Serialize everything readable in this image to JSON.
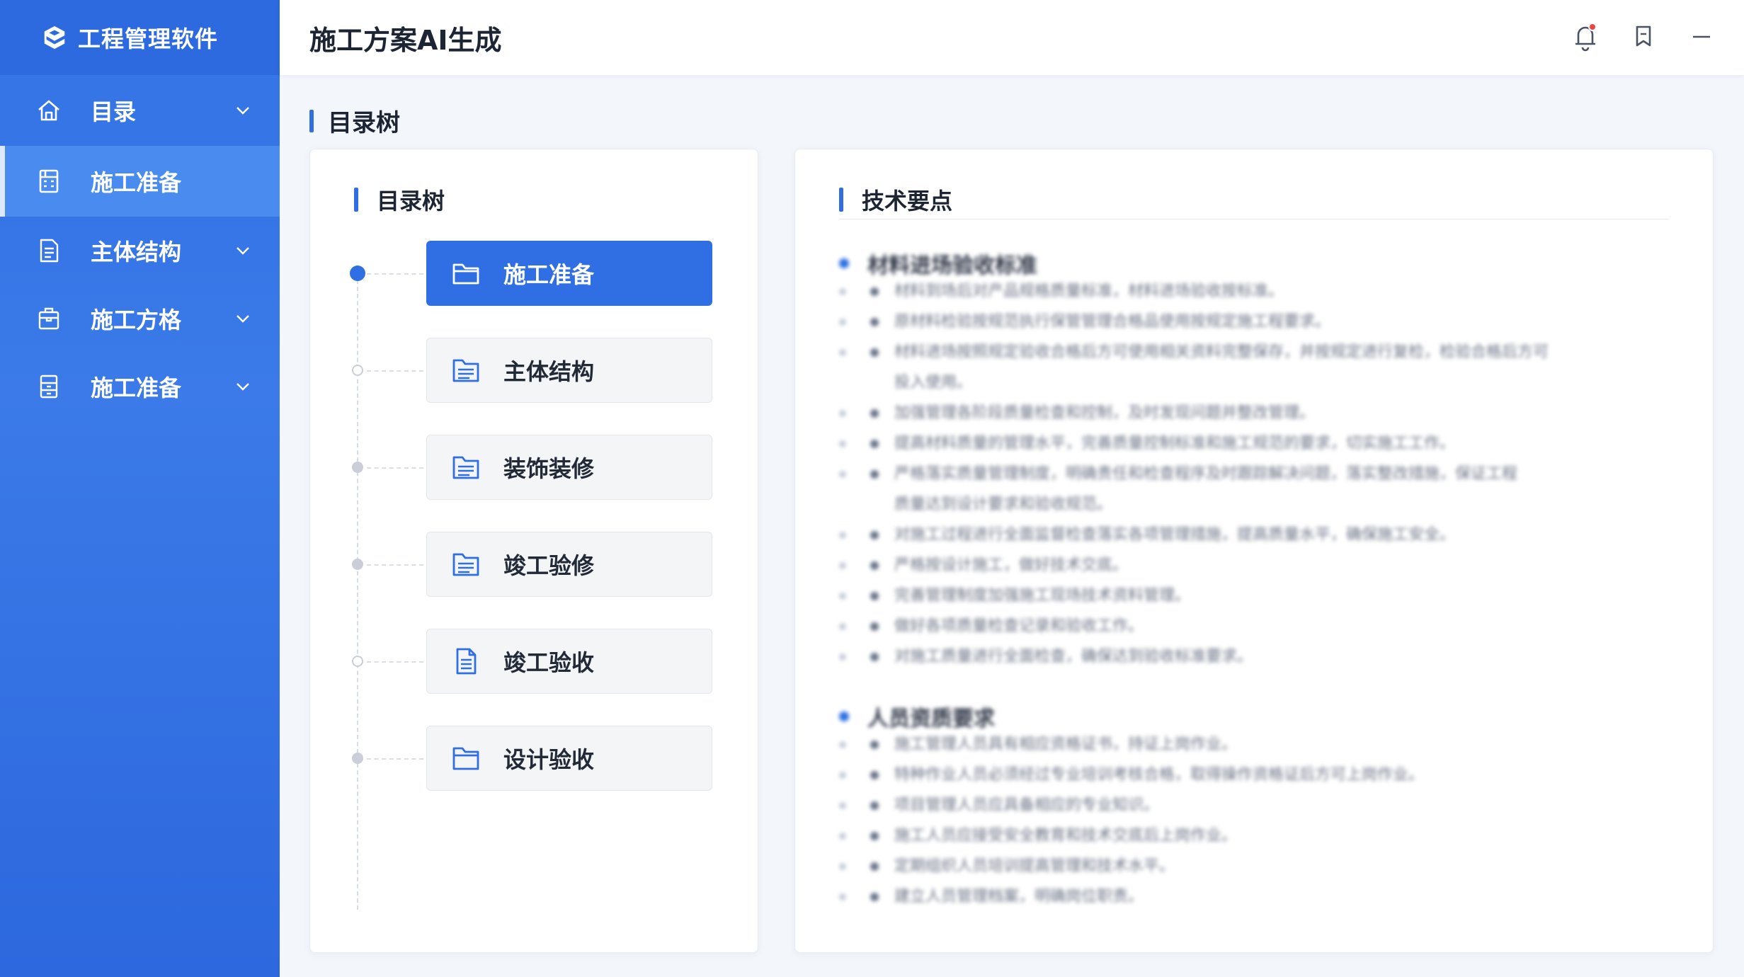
{
  "app": {
    "brand": "工程管理软件",
    "page_title": "施工方案AI生成"
  },
  "sidebar": {
    "items": [
      {
        "label": "目录",
        "icon": "home-icon",
        "expandable": true
      },
      {
        "label": "施工准备",
        "icon": "calculator-icon",
        "active": true
      },
      {
        "label": "主体结构",
        "icon": "document-icon",
        "expandable": true
      },
      {
        "label": "施工方格",
        "icon": "briefcase-icon",
        "expandable": true
      },
      {
        "label": "施工准备",
        "icon": "cabinet-icon",
        "expandable": true
      }
    ]
  },
  "header": {
    "icons": [
      "bell-icon",
      "bookmark-icon",
      "minimize-icon"
    ]
  },
  "section": {
    "title": "目录树"
  },
  "tree_panel": {
    "title": "目录树",
    "nodes": [
      {
        "label": "施工准备",
        "active": true,
        "icon": "folder-icon"
      },
      {
        "label": "主体结构",
        "icon": "folder-lines-icon"
      },
      {
        "label": "装饰装修",
        "icon": "folder-lines-icon"
      },
      {
        "label": "竣工验修",
        "icon": "folder-lines-icon"
      },
      {
        "label": "竣工验收",
        "icon": "document-icon"
      },
      {
        "label": "设计验收",
        "icon": "folder-icon"
      }
    ]
  },
  "tech_panel": {
    "title": "技术要点",
    "groups": [
      {
        "title": "材料进场验收标准",
        "lines": [
          {
            "text": "材料到场后对产品规格质量标准，材料进场验收按标准。"
          },
          {
            "text": "原材料检验按规范执行保管管理合格品使用按规定施工程要求。"
          },
          {
            "text": "材料进场按照规定验收合格后方可使用相关资料完整保存，并按规定进行复检，检验合格后方可"
          },
          {
            "text": "投入使用。",
            "cont": true
          },
          {
            "text": "加强管理各阶段质量检查和控制，及时发现问题并整改管理。"
          },
          {
            "text": "提高材料质量的管理水平，完善质量控制标准和施工规范的要求，切实施工工作。"
          },
          {
            "text": "严格落实质量管理制度，明确责任和检查程序及时跟踪解决问题，落实整改措施，保证工程"
          },
          {
            "text": "质量达到设计要求和验收规范。",
            "cont": true
          },
          {
            "text": "对施工过程进行全面监督检查落实各项管理措施，提高质量水平，确保施工安全。"
          },
          {
            "text": "严格按设计施工，做好技术交底。"
          },
          {
            "text": "完善管理制度加强施工现场技术资料管理。"
          },
          {
            "text": "做好各项质量检查记录和验收工作。"
          },
          {
            "text": "对施工质量进行全面检查，确保达到验收标准要求。"
          }
        ]
      },
      {
        "title": "人员资质要求",
        "lines": [
          {
            "text": "施工管理人员具有相应资格证书，持证上岗作业。"
          },
          {
            "text": "特种作业人员必须经过专业培训考核合格，取得操作资格证后方可上岗作业。"
          },
          {
            "text": "项目管理人员应具备相应的专业知识。"
          },
          {
            "text": "施工人员应接受安全教育和技术交底后上岗作业。"
          },
          {
            "text": "定期组织人员培训提高管理和技术水平。"
          },
          {
            "text": "建立人员管理档案，明确岗位职责。"
          }
        ]
      }
    ]
  },
  "colors": {
    "primary": "#2f6fe3",
    "sidebar_bg": "#3b7ae8",
    "card_bg": "#f4f5f7"
  }
}
